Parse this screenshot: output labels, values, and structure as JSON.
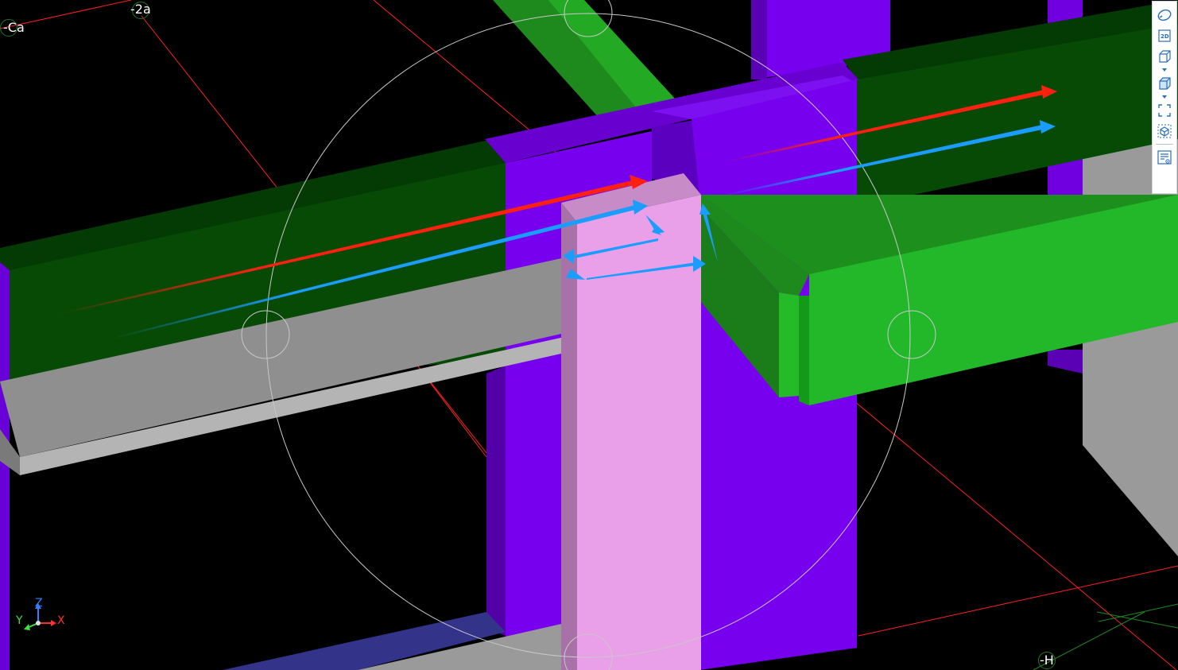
{
  "viewport": {
    "background": "#000000"
  },
  "grid_labels": {
    "ca": "Ca",
    "two_a": "2a",
    "h": "H"
  },
  "colors": {
    "purple_beam": "#7700ee",
    "purple_dark": "#5500b0",
    "green_dark": "#064a06",
    "green_bright": "#22b82a",
    "pink_column": "#e9a0e9",
    "grey_beam": "#969696",
    "grid_line": "#ff2020",
    "arrow_red": "#ff2010",
    "arrow_blue": "#1a9dff",
    "view_circle": "#c8c8c8"
  },
  "axes": {
    "x": "X",
    "y": "Y",
    "z": "Z",
    "x_color": "#ff3030",
    "y_color": "#40e040",
    "z_color": "#3080ff"
  },
  "toolbar": {
    "items": [
      {
        "icon": "orbit-icon"
      },
      {
        "icon": "2d-view-icon",
        "label": "2D"
      },
      {
        "icon": "3d-box-icon"
      },
      {
        "icon": "shaded-box-icon"
      },
      {
        "icon": "zoom-extents-icon"
      },
      {
        "icon": "isometric-view-icon"
      },
      {
        "icon": "properties-view-icon"
      }
    ]
  }
}
